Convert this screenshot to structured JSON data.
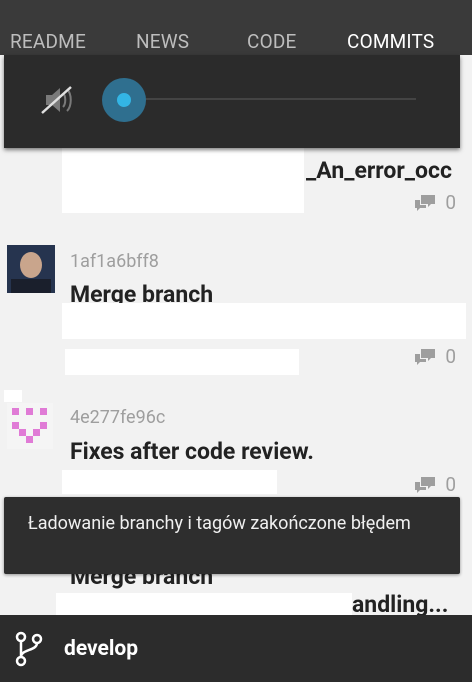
{
  "tabs": [
    "README",
    "NEWS",
    "CODE",
    "COMMITS"
  ],
  "active_tab": "COMMITS",
  "volume_panel": {
    "icon": "volume-muted-icon"
  },
  "commits": [
    {
      "hash": "",
      "title": "_An_error_occ",
      "comments": "0"
    },
    {
      "hash": "1af1a6bff8",
      "title": "Merge branch",
      "comments": "0"
    },
    {
      "hash": "4e277fe96c",
      "title": "Fixes after code review.",
      "comments": "0"
    },
    {
      "hash": "",
      "title": "Merge branch",
      "subtitle": "andling...",
      "comments": ""
    }
  ],
  "toast": {
    "message": "Ładowanie branchy i tagów zakończone błędem"
  },
  "bottom_bar": {
    "branch": "develop",
    "icon": "git-branch-icon"
  },
  "colors": {
    "accent": "#33b5e5",
    "tabbar": "#3a3a3a",
    "bottombar": "#2c2c2c"
  }
}
